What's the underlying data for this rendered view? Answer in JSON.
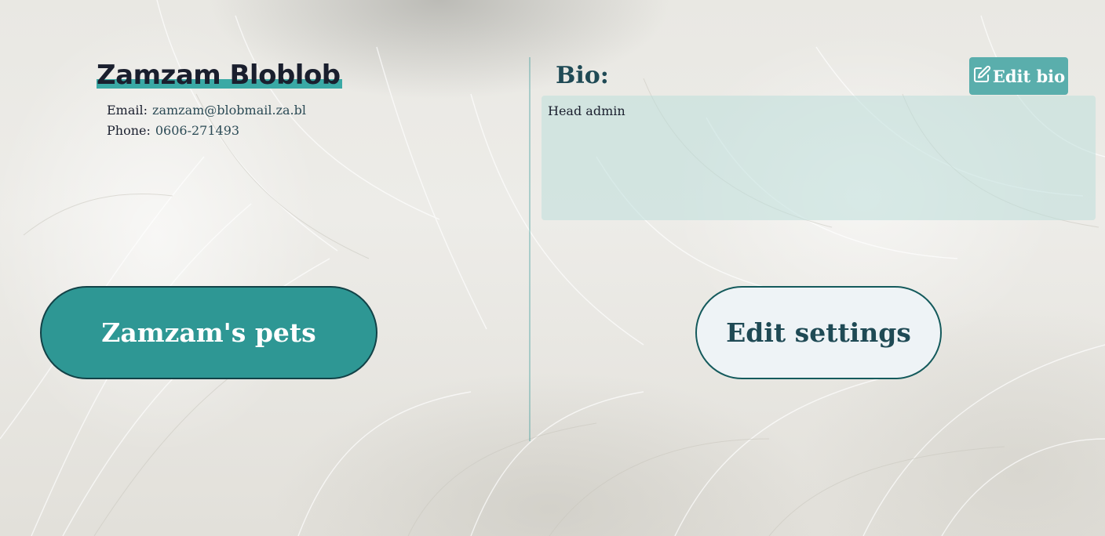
{
  "profile": {
    "name": "Zamzam Bloblob",
    "email_label": "Email:",
    "email_value": "zamzam@blobmail.za.bl",
    "phone_label": "Phone:",
    "phone_value": "0606-271493"
  },
  "bio": {
    "label": "Bio:",
    "edit_label": "Edit bio",
    "edit_icon": "edit-icon",
    "text": "Head admin"
  },
  "actions": {
    "pets_label": "Zamzam's pets",
    "settings_label": "Edit settings"
  },
  "colors": {
    "accent": "#2e9794",
    "edit_bio_bg": "#5aaeac",
    "bio_box_bg": "#bedeDA",
    "heading_text": "#1f4a55"
  }
}
